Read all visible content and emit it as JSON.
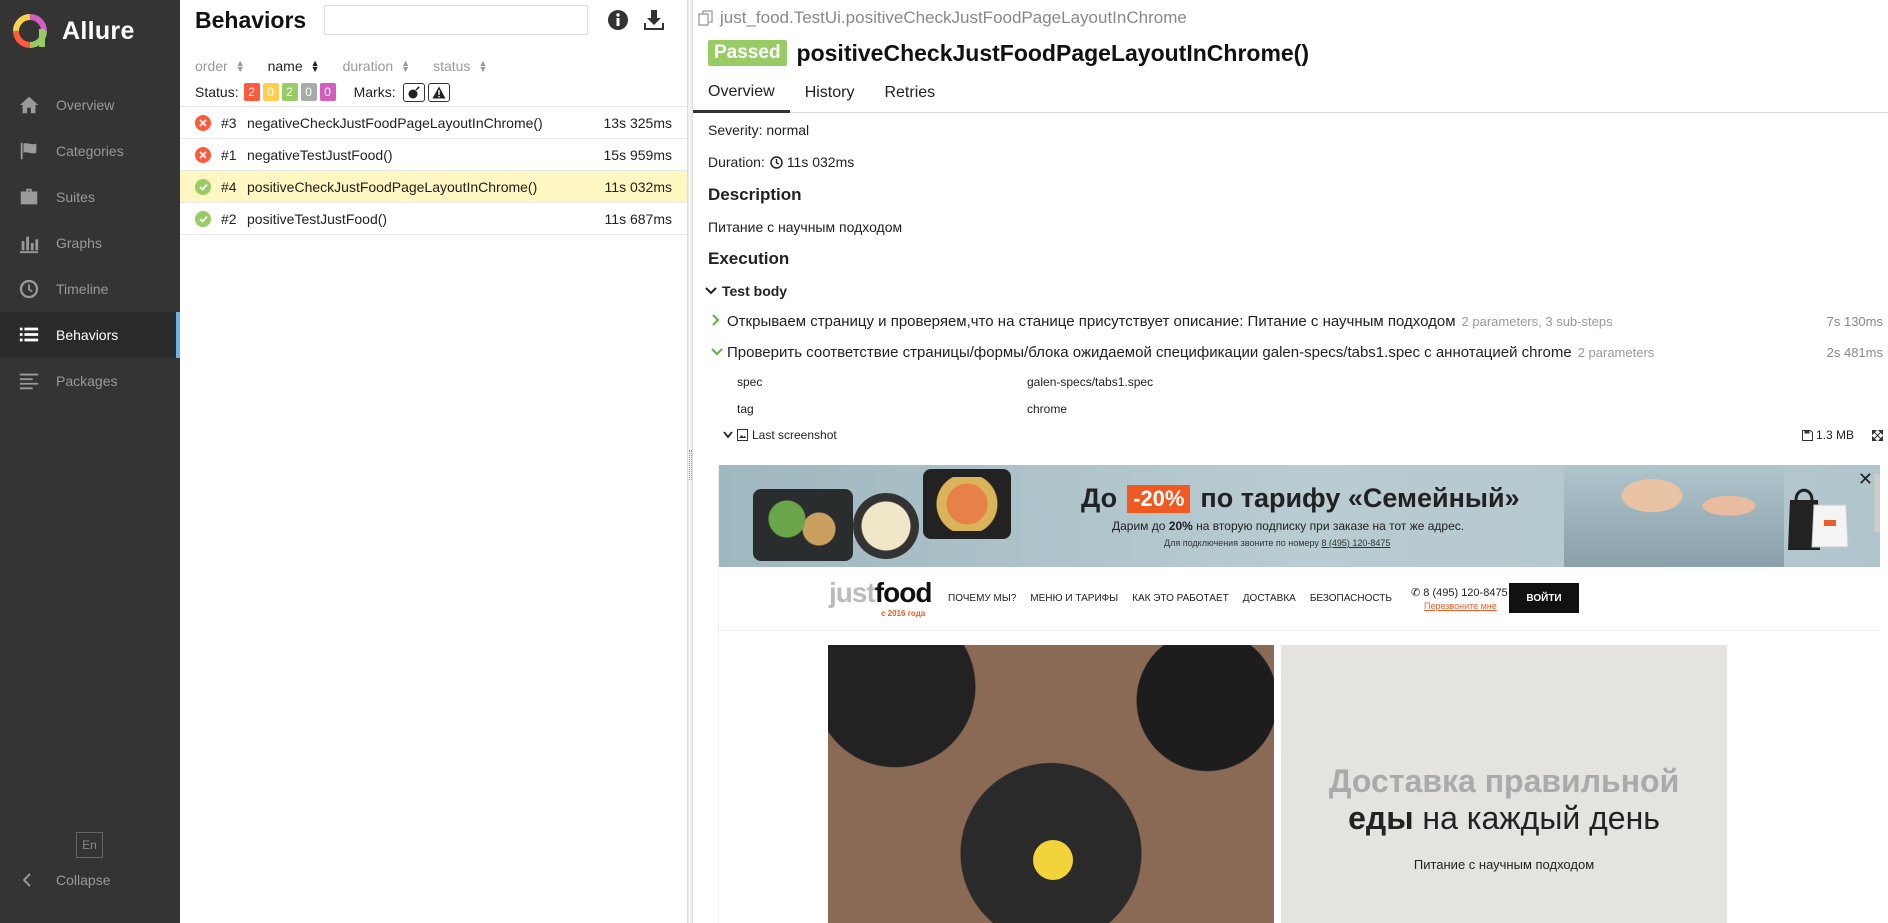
{
  "app": {
    "name": "Allure"
  },
  "sidebar": {
    "items": [
      {
        "label": "Overview",
        "icon": "home-icon"
      },
      {
        "label": "Categories",
        "icon": "flag-icon"
      },
      {
        "label": "Suites",
        "icon": "briefcase-icon"
      },
      {
        "label": "Graphs",
        "icon": "bar-chart-icon"
      },
      {
        "label": "Timeline",
        "icon": "clock-icon"
      },
      {
        "label": "Behaviors",
        "icon": "list-icon",
        "active": true
      },
      {
        "label": "Packages",
        "icon": "align-left-icon"
      }
    ],
    "lang": "En",
    "collapse_label": "Collapse"
  },
  "tree": {
    "title": "Behaviors",
    "search_placeholder": "",
    "sort": [
      "order",
      "name",
      "duration",
      "status"
    ],
    "status_label": "Status:",
    "status_counts": [
      {
        "value": "2",
        "color": "#fd5a3e"
      },
      {
        "value": "0",
        "color": "#ffd050"
      },
      {
        "value": "2",
        "color": "#97cc64"
      },
      {
        "value": "0",
        "color": "#aaaaaa"
      },
      {
        "value": "0",
        "color": "#d35ebe"
      }
    ],
    "marks_label": "Marks:",
    "rows": [
      {
        "num": "#3",
        "name": "negativeCheckJustFoodPageLayoutInChrome()",
        "duration": "13s 325ms",
        "status": "failed"
      },
      {
        "num": "#1",
        "name": "negativeTestJustFood()",
        "duration": "15s 959ms",
        "status": "failed"
      },
      {
        "num": "#4",
        "name": "positiveCheckJustFoodPageLayoutInChrome()",
        "duration": "11s 032ms",
        "status": "passed",
        "selected": true
      },
      {
        "num": "#2",
        "name": "positiveTestJustFood()",
        "duration": "11s 687ms",
        "status": "passed"
      }
    ]
  },
  "details": {
    "breadcrumb": "just_food.TestUi.positiveCheckJustFoodPageLayoutInChrome",
    "status": "Passed",
    "title": "positiveCheckJustFoodPageLayoutInChrome()",
    "tabs": [
      "Overview",
      "History",
      "Retries"
    ],
    "severity": "Severity: normal",
    "duration_label": "Duration:",
    "duration": "11s 032ms",
    "description_heading": "Description",
    "description": "Питание с научным подходом",
    "execution_heading": "Execution",
    "test_body": "Test body",
    "steps": [
      {
        "text": "Открываем страницу и проверяем,что на станице присутствует описание: Питание с научным подходом",
        "meta": "2 parameters, 3 sub-steps",
        "time": "7s 130ms"
      },
      {
        "text": "Проверить соответствие страницы/формы/блока ожидаемой спецификации galen-specs/tabs1.spec с аннотацией chrome",
        "meta": "2 parameters",
        "time": "2s 481ms"
      }
    ],
    "params": [
      {
        "key": "spec",
        "value": "galen-specs/tabs1.spec"
      },
      {
        "key": "tag",
        "value": "chrome"
      }
    ],
    "attachment": {
      "name": "Last screenshot",
      "size": "1.3 MB"
    }
  },
  "screenshot": {
    "promo_before": "До",
    "promo_pct": "-20%",
    "promo_after": "по тарифу «Семейный»",
    "promo_sub_pre": "Дарим до",
    "promo_sub_bold": "20%",
    "promo_sub_post": "на вторую подписку при заказе на тот же адрес.",
    "promo_phone_pre": "Для подключения звоните по номеру",
    "promo_phone": "8 (495) 120-8475",
    "logo_just": "just",
    "logo_food": "food",
    "logo_since": "с 2016 года",
    "menu": [
      "ПОЧЕМУ МЫ?",
      "МЕНЮ И ТАРИФЫ",
      "КАК ЭТО РАБОТАЕТ",
      "ДОСТАВКА",
      "БЕЗОПАСНОСТЬ"
    ],
    "phone": "8 (495) 120-8475",
    "callback": "Перезвоните мне",
    "login": "ВОЙТИ",
    "hero_line1": "Доставка правильной",
    "hero_line2_bold": "еды",
    "hero_line2_rest": "на каждый день",
    "hero_sub": "Питание с научным подходом"
  }
}
